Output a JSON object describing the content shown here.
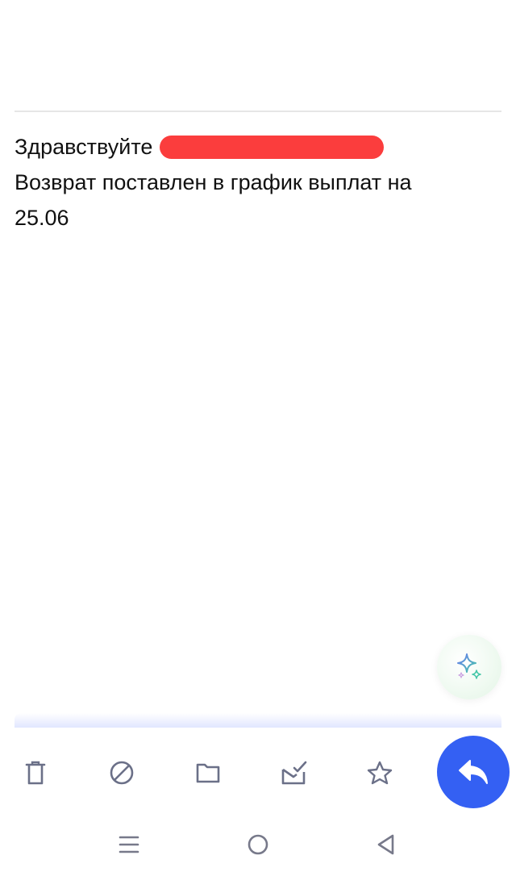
{
  "message": {
    "greeting": "Здравствуйте",
    "line2": "Возврат поставлен в график выплат на",
    "line3": "25.06"
  },
  "fab": {
    "ai_icon": "sparkle-icon"
  },
  "toolbar": {
    "icons": [
      "trash-icon",
      "block-icon",
      "folder-icon",
      "mark-read-icon",
      "star-icon"
    ],
    "reply_icon": "reply-icon"
  },
  "navbar": {
    "icons": [
      "recent-apps-icon",
      "home-icon",
      "back-icon"
    ]
  },
  "colors": {
    "accent": "#3460f3",
    "icon": "#6b7088",
    "redaction": "#fb3d3d"
  }
}
